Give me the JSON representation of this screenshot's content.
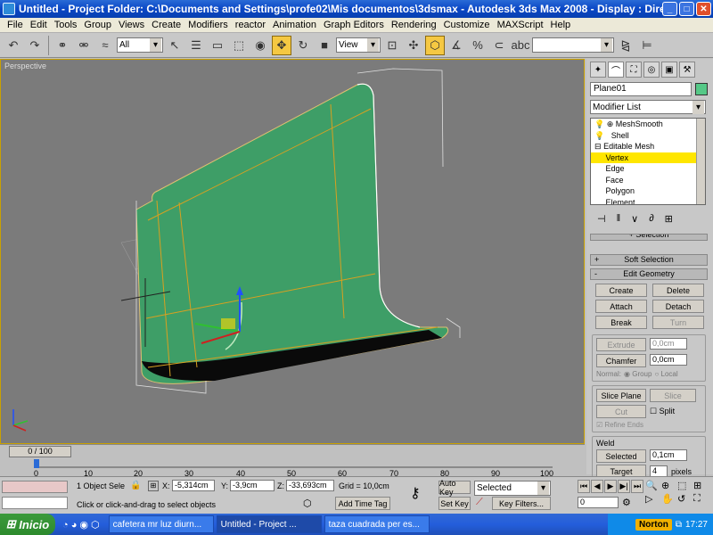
{
  "window": {
    "title": "Untitled    - Project Folder: C:\\Documents and Settings\\profe02\\Mis documentos\\3dsmax    - Autodesk 3ds Max 2008    - Display : Direct 3D",
    "min": "_",
    "max": "□",
    "close": "✕"
  },
  "menu": [
    "File",
    "Edit",
    "Tools",
    "Group",
    "Views",
    "Create",
    "Modifiers",
    "reactor",
    "Animation",
    "Graph Editors",
    "Rendering",
    "Customize",
    "MAXScript",
    "Help"
  ],
  "toolbar": {
    "selection_filter": "All",
    "ref_coord": "View",
    "named_sel": ""
  },
  "viewport": {
    "label": "Perspective"
  },
  "command_panel": {
    "object_name": "Plane01",
    "object_color": "#55c887",
    "modifier_list": "Modifier List",
    "stack": [
      {
        "label": "MeshSmooth",
        "prefix": "⊕"
      },
      {
        "label": "Shell",
        "prefix": ""
      },
      {
        "label": "Editable Mesh",
        "prefix": "⊟"
      },
      {
        "label": "Vertex",
        "prefix": "",
        "selected": true
      },
      {
        "label": "Edge",
        "prefix": ""
      },
      {
        "label": "Face",
        "prefix": ""
      },
      {
        "label": "Polygon",
        "prefix": ""
      },
      {
        "label": "Element",
        "prefix": ""
      }
    ],
    "stack_icons": [
      "⊣",
      "‖",
      "∨",
      "∂",
      "⊞"
    ],
    "rollout_top_fragment": "+ Selection",
    "soft_selection": "Soft Selection",
    "edit_geometry": "Edit Geometry",
    "buttons": {
      "create": "Create",
      "delete": "Delete",
      "attach": "Attach",
      "detach": "Detach",
      "break": "Break",
      "turn": "Turn",
      "extrude": "Extrude",
      "extrude_val": "0,0cm",
      "chamfer": "Chamfer",
      "chamfer_val": "0,0cm",
      "normal": "Normal:",
      "group": "Group",
      "local": "Local",
      "slice_plane": "Slice Plane",
      "slice": "Slice",
      "cut": "Cut",
      "split": "Split",
      "refine_ends": "Refine Ends",
      "weld": "Weld",
      "selected": "Selected",
      "selected_val": "0,1cm",
      "target": "Target",
      "target_val": "4",
      "pixels": "pixels"
    }
  },
  "timeline": {
    "slider": "0 / 100",
    "ticks": [
      "0",
      "10",
      "20",
      "30",
      "40",
      "50",
      "60",
      "70",
      "80",
      "90",
      "100"
    ]
  },
  "status": {
    "selection": "1 Object Sele",
    "x_label": "X:",
    "x": "-5,314cm",
    "y_label": "Y:",
    "y": "-3,9cm",
    "z_label": "Z:",
    "z": "-33,693cm",
    "grid": "Grid = 10,0cm",
    "prompt": "Click or click-and-drag to select objects",
    "add_time_tag": "Add Time Tag",
    "auto_key": "Auto Key",
    "set_key": "Set Key",
    "key_mode": "Selected",
    "key_filters": "Key Filters...",
    "frame": "0"
  },
  "taskbar": {
    "start": "Inicio",
    "tasks": [
      "cafetera mr luz diurn...",
      "Untitled    - Project ...",
      "taza cuadrada per es..."
    ],
    "norton": "Norton",
    "clock": "17:27"
  }
}
